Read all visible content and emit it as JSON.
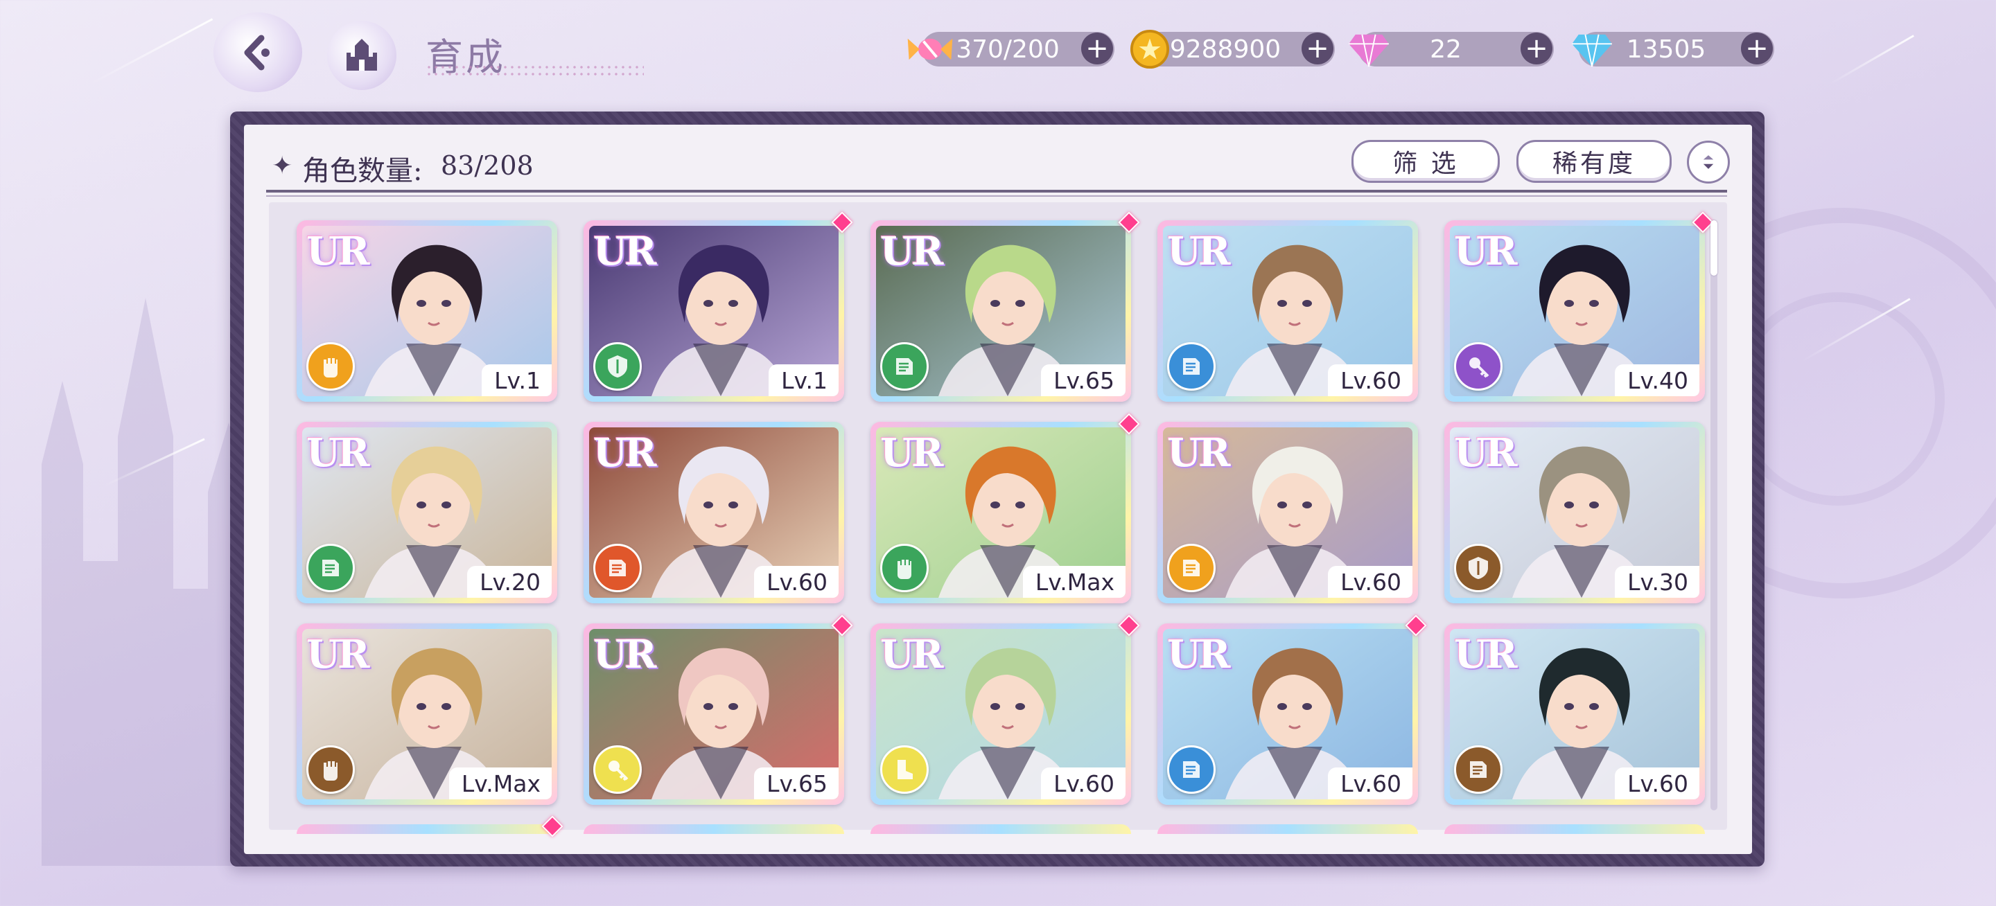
{
  "header": {
    "title": "育成"
  },
  "resources": [
    {
      "name": "stamina",
      "icon": "candy-icon",
      "value": "370/200",
      "color": "#ff7eb6"
    },
    {
      "name": "gold",
      "icon": "gold-coin-icon",
      "value": "9288900",
      "color": "#f4b621"
    },
    {
      "name": "pink_diamond",
      "icon": "pink-diamond-icon",
      "value": "22",
      "color": "#e87ad4"
    },
    {
      "name": "blue_diamond",
      "icon": "blue-diamond-icon",
      "value": "13505",
      "color": "#58c4f0"
    }
  ],
  "panel": {
    "count_label": "角色数量:",
    "count_value": "83/208",
    "filter_label": "筛 选",
    "rarity_label": "稀有度"
  },
  "cards": [
    {
      "rarity": "UR",
      "level": "Lv.1",
      "element": "fist",
      "element_color": "#f0a11d",
      "new": false,
      "bg": [
        "#f6d5e6",
        "#a7c8ea"
      ],
      "hair": "#2b1f2c"
    },
    {
      "rarity": "UR",
      "level": "Lv.1",
      "element": "shield",
      "element_color": "#3ba55c",
      "new": true,
      "bg": [
        "#4a3a73",
        "#b7a6d6"
      ],
      "hair": "#3a2a63"
    },
    {
      "rarity": "UR",
      "level": "Lv.65",
      "element": "book",
      "element_color": "#3ba55c",
      "new": true,
      "bg": [
        "#5a6b52",
        "#a9c7d5"
      ],
      "hair": "#b9d98a"
    },
    {
      "rarity": "UR",
      "level": "Lv.60",
      "element": "book",
      "element_color": "#3a8fd8",
      "new": false,
      "bg": [
        "#bfe0f2",
        "#9cc7e8"
      ],
      "hair": "#9b7554"
    },
    {
      "rarity": "UR",
      "level": "Lv.40",
      "element": "key",
      "element_color": "#8e52c9",
      "new": true,
      "bg": [
        "#b9dff2",
        "#9fb7e0"
      ],
      "hair": "#1e1a2c"
    },
    {
      "rarity": "UR",
      "level": "Lv.20",
      "element": "book",
      "element_color": "#3ba55c",
      "new": false,
      "bg": [
        "#dfe6f0",
        "#c9b59a"
      ],
      "hair": "#e6cf98"
    },
    {
      "rarity": "UR",
      "level": "Lv.60",
      "element": "book",
      "element_color": "#e0572b",
      "new": false,
      "bg": [
        "#8e4a3a",
        "#e9d2b9"
      ],
      "hair": "#eae7f2"
    },
    {
      "rarity": "UR",
      "level": "Lv.Max",
      "element": "fist",
      "element_color": "#3ba55c",
      "new": true,
      "bg": [
        "#d9e8b8",
        "#9fd091"
      ],
      "hair": "#d9782b"
    },
    {
      "rarity": "UR",
      "level": "Lv.60",
      "element": "book",
      "element_color": "#f0a11d",
      "new": false,
      "bg": [
        "#d6b99a",
        "#a79bc8"
      ],
      "hair": "#f0efe8"
    },
    {
      "rarity": "UR",
      "level": "Lv.30",
      "element": "shield",
      "element_color": "#8b5a2b",
      "new": false,
      "bg": [
        "#e2ebf5",
        "#c6c9d6"
      ],
      "hair": "#9b9280"
    },
    {
      "rarity": "UR",
      "level": "Lv.Max",
      "element": "fist",
      "element_color": "#8b5a2b",
      "new": false,
      "bg": [
        "#e9e3dc",
        "#c7b39d"
      ],
      "hair": "#c8a060"
    },
    {
      "rarity": "UR",
      "level": "Lv.65",
      "element": "key",
      "element_color": "#efe04f",
      "new": true,
      "bg": [
        "#6e8f6a",
        "#d96b6b"
      ],
      "hair": "#efc7c2"
    },
    {
      "rarity": "UR",
      "level": "Lv.60",
      "element": "boot",
      "element_color": "#efe04f",
      "new": true,
      "bg": [
        "#c9e5c9",
        "#b1d6e6"
      ],
      "hair": "#b6d39a"
    },
    {
      "rarity": "UR",
      "level": "Lv.60",
      "element": "book",
      "element_color": "#3a8fd8",
      "new": true,
      "bg": [
        "#b9dff2",
        "#8cb6e2"
      ],
      "hair": "#a2704a"
    },
    {
      "rarity": "UR",
      "level": "Lv.60",
      "element": "book",
      "element_color": "#8b5a2b",
      "new": false,
      "bg": [
        "#cfe6f2",
        "#a7c3d9"
      ],
      "hair": "#1f2a2e"
    }
  ],
  "icons": {
    "back": "back-arrow-icon",
    "home": "castle-home-icon",
    "sort": "sort-toggle-icon",
    "plus": "+"
  }
}
